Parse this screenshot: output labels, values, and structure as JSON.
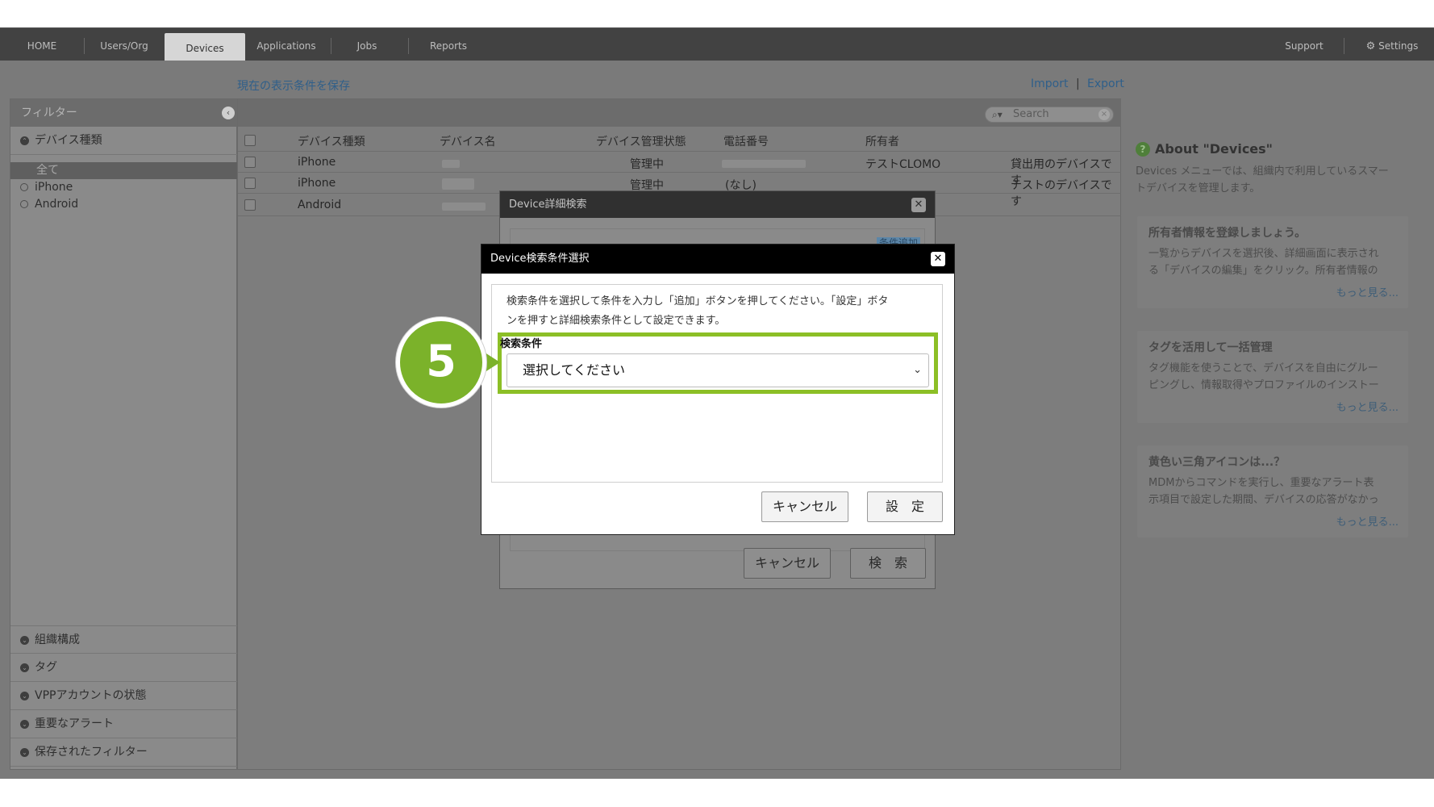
{
  "topnav": {
    "items": [
      "HOME",
      "Users/Org",
      "Devices",
      "Applications",
      "Jobs",
      "Reports"
    ],
    "active": "Devices",
    "right_items": [
      "Support",
      "Settings"
    ]
  },
  "subheader": {
    "save_view": "現在の表示条件を保存",
    "import": "Import",
    "separator": "|",
    "export": "Export"
  },
  "sidebar": {
    "title": "フィルター",
    "device_type": "デバイス種類",
    "device_type_items": [
      "全て",
      "iPhone",
      "Android"
    ],
    "sections": [
      "組織構成",
      "タグ",
      "VPPアカウントの状態",
      "重要なアラート",
      "保存されたフィルター"
    ]
  },
  "table": {
    "search_placeholder": "Search",
    "columns": [
      "デバイス種類",
      "デバイス名",
      "デバイス管理状態",
      "電話番号",
      "所有者"
    ],
    "rows": [
      {
        "type": "iPhone",
        "status": "管理中",
        "phone": "",
        "owner": "テストCLOMO",
        "note": "貸出用のデバイスです"
      },
      {
        "type": "iPhone",
        "status": "管理中",
        "phone": "(なし)",
        "owner": "",
        "note": "テストのデバイスです"
      },
      {
        "type": "Android",
        "status": "",
        "phone": "",
        "owner": "",
        "note": ""
      }
    ]
  },
  "right_panel": {
    "title": "About \"Devices\"",
    "intro": [
      "Devices メニューでは、組織内で利用しているスマー",
      "トデバイスを管理します。"
    ],
    "cards": [
      {
        "head": "所有者情報を登録しましょう。",
        "lines": [
          "一覧からデバイスを選択後、詳細画面に表示され",
          "る「デバイスの編集」をクリック。所有者情報の"
        ],
        "more": "もっと見る..."
      },
      {
        "head": "タグを活用して一括管理",
        "lines": [
          "タグ機能を使うことで、デバイスを自由にグルー",
          "ピングし、情報取得やプロファイルのインストー"
        ],
        "more": "もっと見る..."
      },
      {
        "head": "黄色い三角アイコンは...？",
        "lines": [
          "MDMからコマンドを実行し、重要なアラート表",
          "示項目で設定した期間、デバイスの応答がなかっ"
        ],
        "more": "もっと見る..."
      }
    ]
  },
  "detail_dialog": {
    "title": "Device詳細検索",
    "add_condition": "条件追加",
    "cancel": "キャンセル",
    "search": "検　索"
  },
  "cond_dialog": {
    "title": "Device検索条件選択",
    "description": [
      "検索条件を選択して条件を入力し「追加」ボタンを押してください。「設定」ボタ",
      "ンを押すと詳細検索条件として設定できます。"
    ],
    "field_label": "検索条件",
    "select_value": "選択してください",
    "cancel": "キャンセル",
    "ok": "設　定"
  },
  "step_badge": "5"
}
